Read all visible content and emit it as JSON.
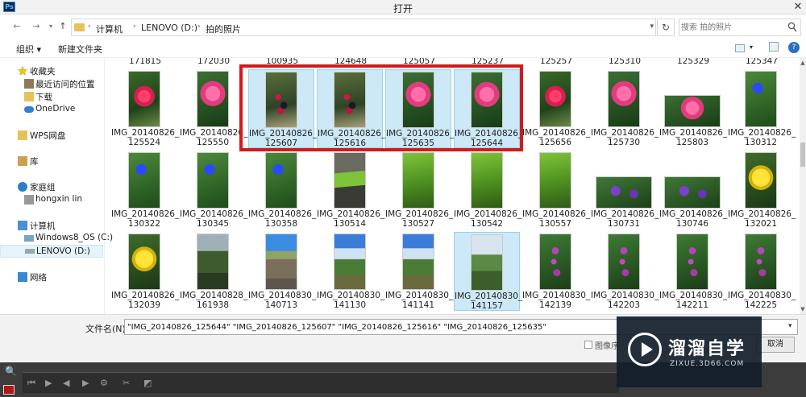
{
  "window": {
    "title": "打开",
    "app_icon": "Ps"
  },
  "address": {
    "crumbs": [
      "计算机",
      "LENOVO (D:)",
      "拍的照片"
    ],
    "search_placeholder": "搜索 拍的照片"
  },
  "toolbar": {
    "organize": "组织 ▾",
    "new_folder": "新建文件夹"
  },
  "nav": {
    "favorites": "收藏夹",
    "recent": "最近访问的位置",
    "downloads": "下载",
    "onedrive": "OneDrive",
    "wps": "WPS网盘",
    "library": "库",
    "homegroup": "家庭组",
    "user": "hongxin lin",
    "computer": "计算机",
    "drive_c": "Windows8_OS (C:)",
    "drive_d": "LENOVO (D:)",
    "network": "网络"
  },
  "top_row_labels": [
    "171815",
    "172030",
    "100935",
    "124648",
    "125057",
    "125237",
    "125257",
    "125310",
    "125329",
    "125347"
  ],
  "rows": [
    [
      {
        "l1": "IMG_20140826_",
        "l2": "125524",
        "sel": false
      },
      {
        "l1": "IMG_20140826_",
        "l2": "125550",
        "sel": false
      },
      {
        "l1": "IMG_20140826_",
        "l2": "125607",
        "sel": true
      },
      {
        "l1": "IMG_20140826_",
        "l2": "125616",
        "sel": true
      },
      {
        "l1": "IMG_20140826_",
        "l2": "125635",
        "sel": true
      },
      {
        "l1": "IMG_20140826_",
        "l2": "125644",
        "sel": true
      },
      {
        "l1": "IMG_20140826_",
        "l2": "125656",
        "sel": false
      },
      {
        "l1": "IMG_20140826_",
        "l2": "125730",
        "sel": false
      },
      {
        "l1": "IMG_20140826_",
        "l2": "125803",
        "sel": false
      },
      {
        "l1": "IMG_20140826_",
        "l2": "130312",
        "sel": false
      }
    ],
    [
      {
        "l1": "IMG_20140826_",
        "l2": "130322",
        "sel": false
      },
      {
        "l1": "IMG_20140826_",
        "l2": "130345",
        "sel": false
      },
      {
        "l1": "IMG_20140826_",
        "l2": "130358",
        "sel": false
      },
      {
        "l1": "IMG_20140826_",
        "l2": "130514",
        "sel": false
      },
      {
        "l1": "IMG_20140826_",
        "l2": "130527",
        "sel": false
      },
      {
        "l1": "IMG_20140826_",
        "l2": "130542",
        "sel": false
      },
      {
        "l1": "IMG_20140826_",
        "l2": "130557",
        "sel": false
      },
      {
        "l1": "IMG_20140826_",
        "l2": "130731",
        "sel": false
      },
      {
        "l1": "IMG_20140826_",
        "l2": "130746",
        "sel": false
      },
      {
        "l1": "IMG_20140826_",
        "l2": "132021",
        "sel": false
      }
    ],
    [
      {
        "l1": "IMG_20140826_",
        "l2": "132039",
        "sel": false
      },
      {
        "l1": "IMG_20140828_",
        "l2": "161938",
        "sel": false
      },
      {
        "l1": "IMG_20140830_",
        "l2": "140713",
        "sel": false
      },
      {
        "l1": "IMG_20140830_",
        "l2": "141130",
        "sel": false
      },
      {
        "l1": "IMG_20140830_",
        "l2": "141141",
        "sel": false
      },
      {
        "l1": "IMG_20140830_",
        "l2": "141157",
        "sel": true
      },
      {
        "l1": "IMG_20140830_",
        "l2": "142139",
        "sel": false
      },
      {
        "l1": "IMG_20140830_",
        "l2": "142203",
        "sel": false
      },
      {
        "l1": "IMG_20140830_",
        "l2": "142211",
        "sel": false
      },
      {
        "l1": "IMG_20140830_",
        "l2": "142225",
        "sel": false
      }
    ]
  ],
  "filename": {
    "label": "文件名(N):",
    "value": "\"IMG_20140826_125644\" \"IMG_20140826_125607\" \"IMG_20140826_125616\" \"IMG_20140826_125635\""
  },
  "image_sequence_label": "图像序",
  "cancel_label": "取消",
  "watermark": {
    "cn": "溜溜自学",
    "en": "ZIXUE.3D66.COM"
  }
}
